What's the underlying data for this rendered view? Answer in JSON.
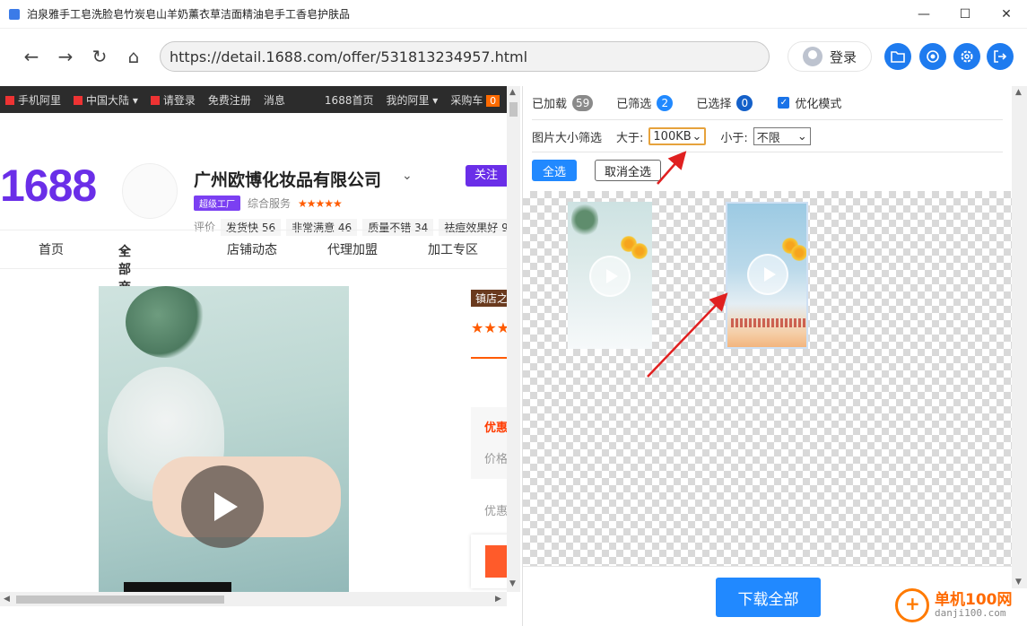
{
  "window": {
    "title": "泊泉雅手工皂洗脸皂竹炭皂山羊奶薰衣草洁面精油皂手工香皂护肤品",
    "minimize_glyph": "—",
    "maximize_glyph": "☐",
    "close_glyph": "✕"
  },
  "nav": {
    "back_glyph": "←",
    "forward_glyph": "→",
    "reload_glyph": "↻",
    "home_glyph": "⌂",
    "url": "https://detail.1688.com/offer/531813234957.html",
    "login_label": "登录",
    "icons": [
      "folder-icon",
      "help-icon",
      "settings-icon",
      "exit-icon"
    ]
  },
  "webpage": {
    "topstrip": [
      "手机阿里",
      "中国大陆",
      "请登录",
      "免费注册",
      "消息",
      "1688首页",
      "我的阿里",
      "采购车"
    ],
    "cart_count": "0",
    "logo": "1688",
    "shop_name": "广州欧博化妆品有限公司",
    "follow_label": "关注",
    "super_badge": "超级工厂",
    "service_label": "综合服务",
    "stars": "★★★★★",
    "rating_label": "评价",
    "ratings": [
      "发货快 56",
      "非常满意 46",
      "质量不错 34",
      "祛痘效果好 9"
    ],
    "shop_nav": [
      "首页",
      "全部商品",
      "店铺动态",
      "代理加盟",
      "加工专区"
    ],
    "store_tag": "镇店之宝",
    "promo_title": "优惠",
    "price_label": "价格",
    "promo_label": "优惠"
  },
  "panel": {
    "loaded_label": "已加载",
    "loaded_count": "59",
    "filtered_label": "已筛选",
    "filtered_count": "2",
    "selected_label": "已选择",
    "selected_count": "0",
    "optimize_label": "优化模式",
    "optimize_checked": true,
    "size_filter_label": "图片大小筛选",
    "greater_label": "大于:",
    "greater_value": "100KB",
    "less_label": "小于:",
    "less_value": "不限",
    "select_all_label": "全选",
    "deselect_all_label": "取消全选",
    "download_all_label": "下载全部"
  },
  "watermark": {
    "line1": "单机100网",
    "line2": "danji100.com"
  },
  "colors": {
    "accent": "#2189ff",
    "brand_1688": "#6a2ee8",
    "highlight_border": "#e6a23c",
    "arrow": "#e02020"
  }
}
